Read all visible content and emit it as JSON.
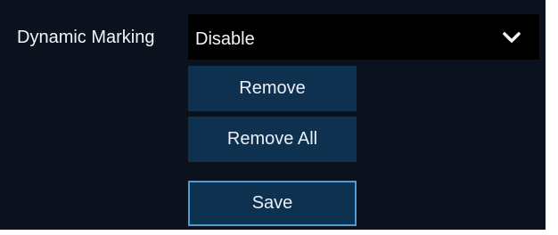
{
  "form": {
    "dynamic_marking": {
      "label": "Dynamic Marking",
      "value": "Disable",
      "arrow_icon": "chevron-down-icon"
    },
    "buttons": {
      "remove": "Remove",
      "remove_all": "Remove All",
      "save": "Save"
    }
  },
  "colors": {
    "background": "#0c121d",
    "select_background": "#000000",
    "button_background": "#0f3150",
    "save_border": "#4d9bd8",
    "text": "#f2f4f7"
  }
}
